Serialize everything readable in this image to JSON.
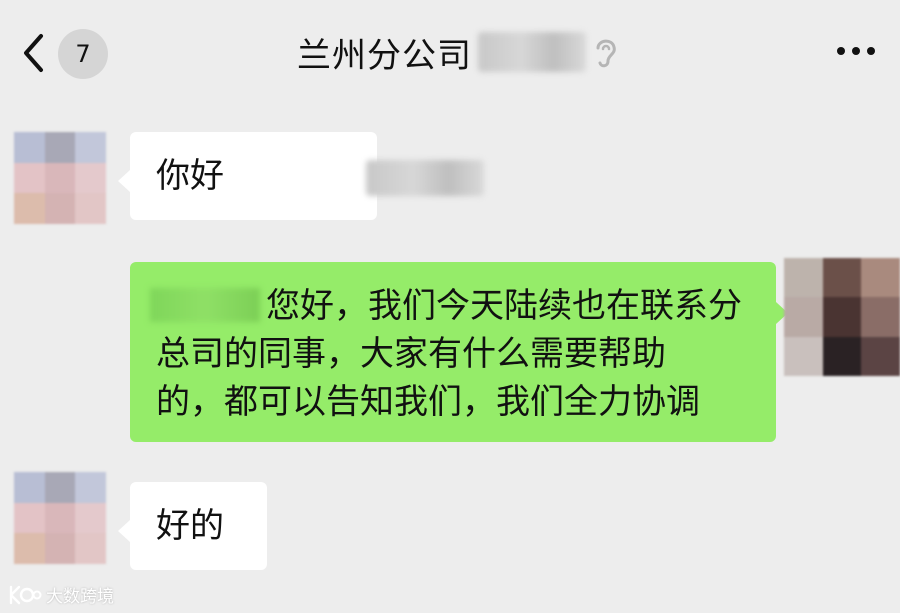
{
  "header": {
    "back_icon": "chevron-left-icon",
    "unread_count": "7",
    "title": "兰州分公司",
    "title_suffix_icon": "ear-icon",
    "more_icon": "more-dots-icon"
  },
  "messages": [
    {
      "side": "left",
      "text": "你好"
    },
    {
      "side": "right",
      "text": "您好，我们今天陆续也在联系分\n总司的同事，大家有什么需要帮助\n的，都可以告知我们，我们全力协调"
    },
    {
      "side": "left",
      "text": "好的"
    }
  ],
  "watermark": {
    "text": "大数跨境"
  },
  "colors": {
    "background": "#ededed",
    "incoming_bubble": "#ffffff",
    "outgoing_bubble": "#95ec69"
  }
}
